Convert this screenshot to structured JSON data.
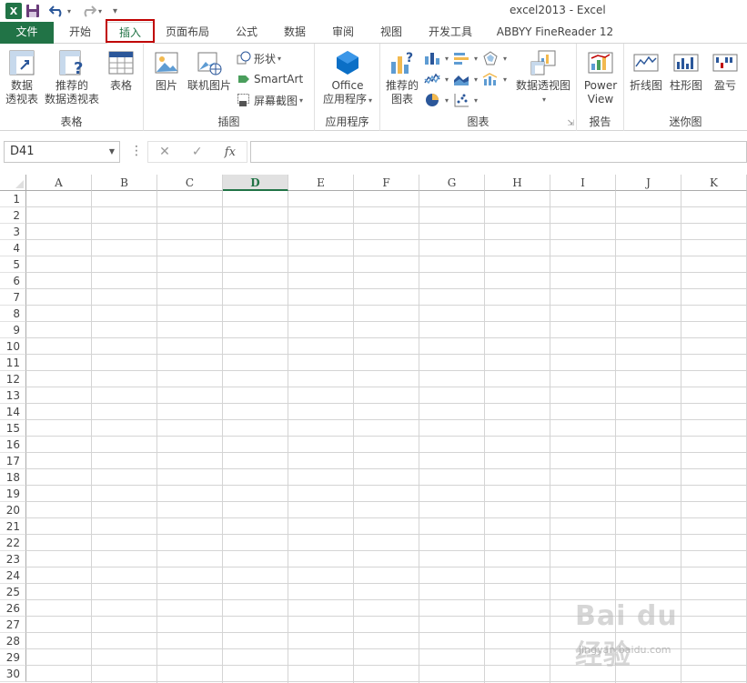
{
  "window": {
    "title": "excel2013 - Excel"
  },
  "quick_access": {
    "customize_glyph": "▾"
  },
  "tabs": [
    {
      "label": "文件"
    },
    {
      "label": "开始"
    },
    {
      "label": "插入"
    },
    {
      "label": "页面布局"
    },
    {
      "label": "公式"
    },
    {
      "label": "数据"
    },
    {
      "label": "审阅"
    },
    {
      "label": "视图"
    },
    {
      "label": "开发工具"
    },
    {
      "label": "ABBYY FineReader 12"
    }
  ],
  "active_tab": "插入",
  "ribbon": {
    "tables": {
      "label": "表格",
      "pivot_line1": "数据",
      "pivot_line2": "透视表",
      "recommended_pivot_line1": "推荐的",
      "recommended_pivot_line2": "数据透视表",
      "table": "表格"
    },
    "illustrations": {
      "label": "插图",
      "pictures": "图片",
      "online_pictures": "联机图片",
      "shapes": "形状",
      "smartart": "SmartArt",
      "screenshot": "屏幕截图"
    },
    "apps": {
      "label": "应用程序",
      "office_line1": "Office",
      "office_line2": "应用程序"
    },
    "charts": {
      "label": "图表",
      "recommended_line1": "推荐的",
      "recommended_line2": "图表",
      "pivot_chart": "数据透视图"
    },
    "reports": {
      "label": "报告",
      "power_line1": "Power",
      "power_line2": "View"
    },
    "sparklines": {
      "label": "迷你图",
      "line": "折线图",
      "column": "柱形图",
      "winloss": "盈亏"
    }
  },
  "formula_bar": {
    "name_box": "D41",
    "cancel": "✕",
    "enter": "✓",
    "fx": "fx",
    "formula": ""
  },
  "grid": {
    "columns": [
      "A",
      "B",
      "C",
      "D",
      "E",
      "F",
      "G",
      "H",
      "I",
      "J",
      "K"
    ],
    "selected_column": "D",
    "rows": [
      "1",
      "2",
      "3",
      "4",
      "5",
      "6",
      "7",
      "8",
      "9",
      "10",
      "11",
      "12",
      "13",
      "14",
      "15",
      "16",
      "17",
      "18",
      "19",
      "20",
      "21",
      "22",
      "23",
      "24",
      "25",
      "26",
      "27",
      "28",
      "29",
      "30"
    ]
  },
  "watermark": {
    "brand": "Bai du 经验",
    "url": "jingyan.baidu.com"
  },
  "colors": {
    "accent": "#217346",
    "highlight": "#c00000"
  }
}
